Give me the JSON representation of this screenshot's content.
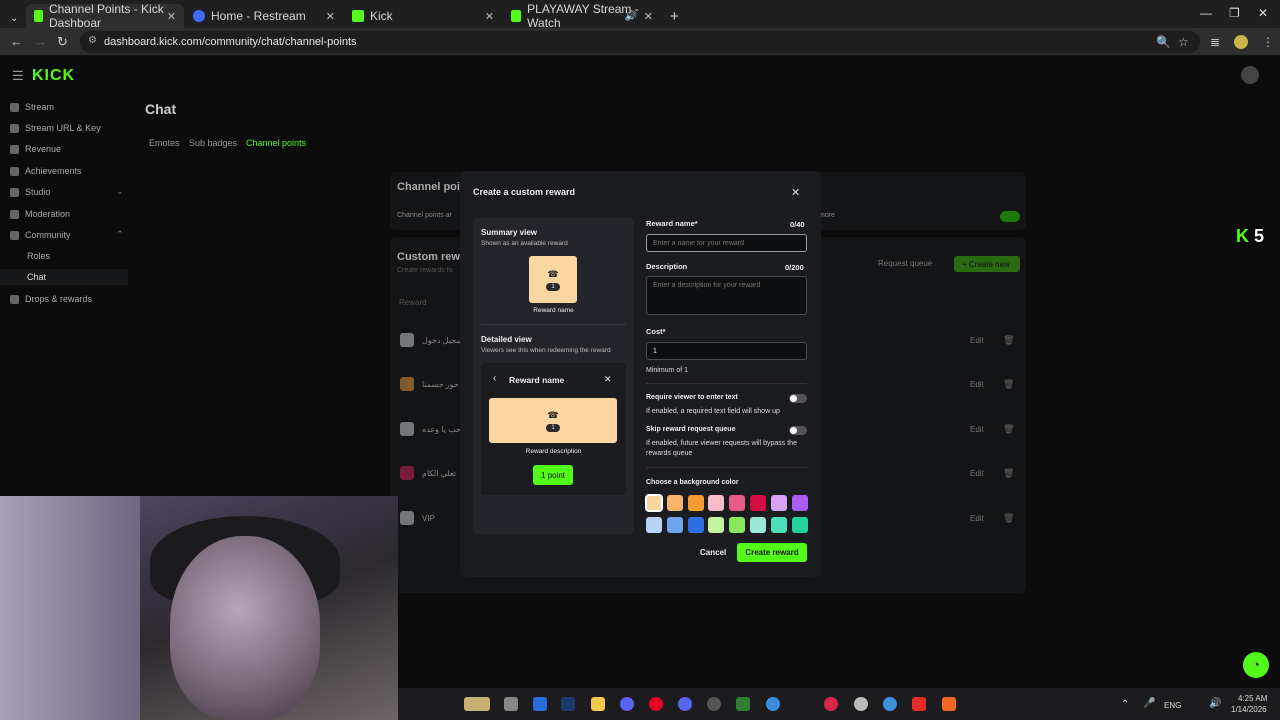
{
  "browser": {
    "tabs": [
      {
        "title": "Channel Points - Kick Dashboar",
        "active": true
      },
      {
        "title": "Home - Restream",
        "active": false
      },
      {
        "title": "Kick",
        "active": false
      },
      {
        "title": "PLAYAWAY Stream - Watch",
        "active": false
      }
    ],
    "url": "dashboard.kick.com/community/chat/channel-points"
  },
  "sidebar": {
    "logo": "KICK",
    "items": [
      {
        "label": "Stream"
      },
      {
        "label": "Stream URL & Key"
      },
      {
        "label": "Revenue"
      },
      {
        "label": "Achievements"
      },
      {
        "label": "Studio"
      },
      {
        "label": "Moderation"
      },
      {
        "label": "Community"
      }
    ],
    "community_sub": [
      "Roles",
      "Chat"
    ],
    "drops": "Drops & rewards"
  },
  "main": {
    "title": "Chat",
    "tabs": [
      "Emotes",
      "Sub badges",
      "Channel points"
    ],
    "bg": {
      "channel_points_card_title": "Channel point",
      "channel_points_desc": "Channel points ar",
      "more_text": "more",
      "custom_rewards_title": "Custom rewar",
      "custom_rewards_desc": "Create rewards fo",
      "request_queue": "Request queue",
      "create_new": "+ Create new",
      "column_reward": "Reward",
      "edit": "Edit",
      "rewards": [
        {
          "name": "تسجيل دخول",
          "color": "#d8d8d8"
        },
        {
          "name": "حور حور جسمنا",
          "color": "#f4a23a"
        },
        {
          "name": "حب يا وعده",
          "color": "#d8d8d8"
        },
        {
          "name": "تغلي الكام",
          "color": "#e0245e"
        },
        {
          "name": "VIP",
          "color": "#d8d8d8"
        }
      ]
    }
  },
  "overlay": {
    "k_label": "K",
    "k_count": "5"
  },
  "modal": {
    "title": "Create a custom reward",
    "summary": {
      "title": "Summary view",
      "subtitle": "Shown as an available reward",
      "cost": "1",
      "name": "Reward name"
    },
    "detail": {
      "title": "Detailed view",
      "subtitle": "Viewers see this when redeeming the reward",
      "header": "Reward name",
      "cost": "1",
      "description": "Reward description",
      "button": "1 point"
    },
    "reward_name": {
      "label": "Reward name*",
      "count": "0/40",
      "placeholder": "Enter a name for your reward"
    },
    "description": {
      "label": "Description",
      "count": "0/200",
      "placeholder": "Enter a description for your reward"
    },
    "cost": {
      "label": "Cost*",
      "value": "1",
      "help": "Minimum of 1"
    },
    "require_text": {
      "label": "Require viewer to enter text",
      "help": "If enabled, a required text field will show up"
    },
    "skip_queue": {
      "label": "Skip reward request queue",
      "help": "If enabled, future viewer requests will bypass the rewards queue"
    },
    "color_label": "Choose a background color",
    "colors": [
      "#fcd6a0",
      "#f6b66a",
      "#f59a2e",
      "#f9bccb",
      "#ea5b86",
      "#d60c45",
      "#d7a3f2",
      "#ab5cf2",
      "#b7d3f7",
      "#6fa4ef",
      "#2d6fe0",
      "#c5f3a4",
      "#8ae65a",
      "#9be8d6",
      "#4ae0bb",
      "#24d49c"
    ],
    "selected_color": "#fcd6a0",
    "cancel": "Cancel",
    "create": "Create reward"
  },
  "taskbar": {
    "lang": "ENG",
    "time": "4:25 AM",
    "date": "1/14/2026"
  }
}
